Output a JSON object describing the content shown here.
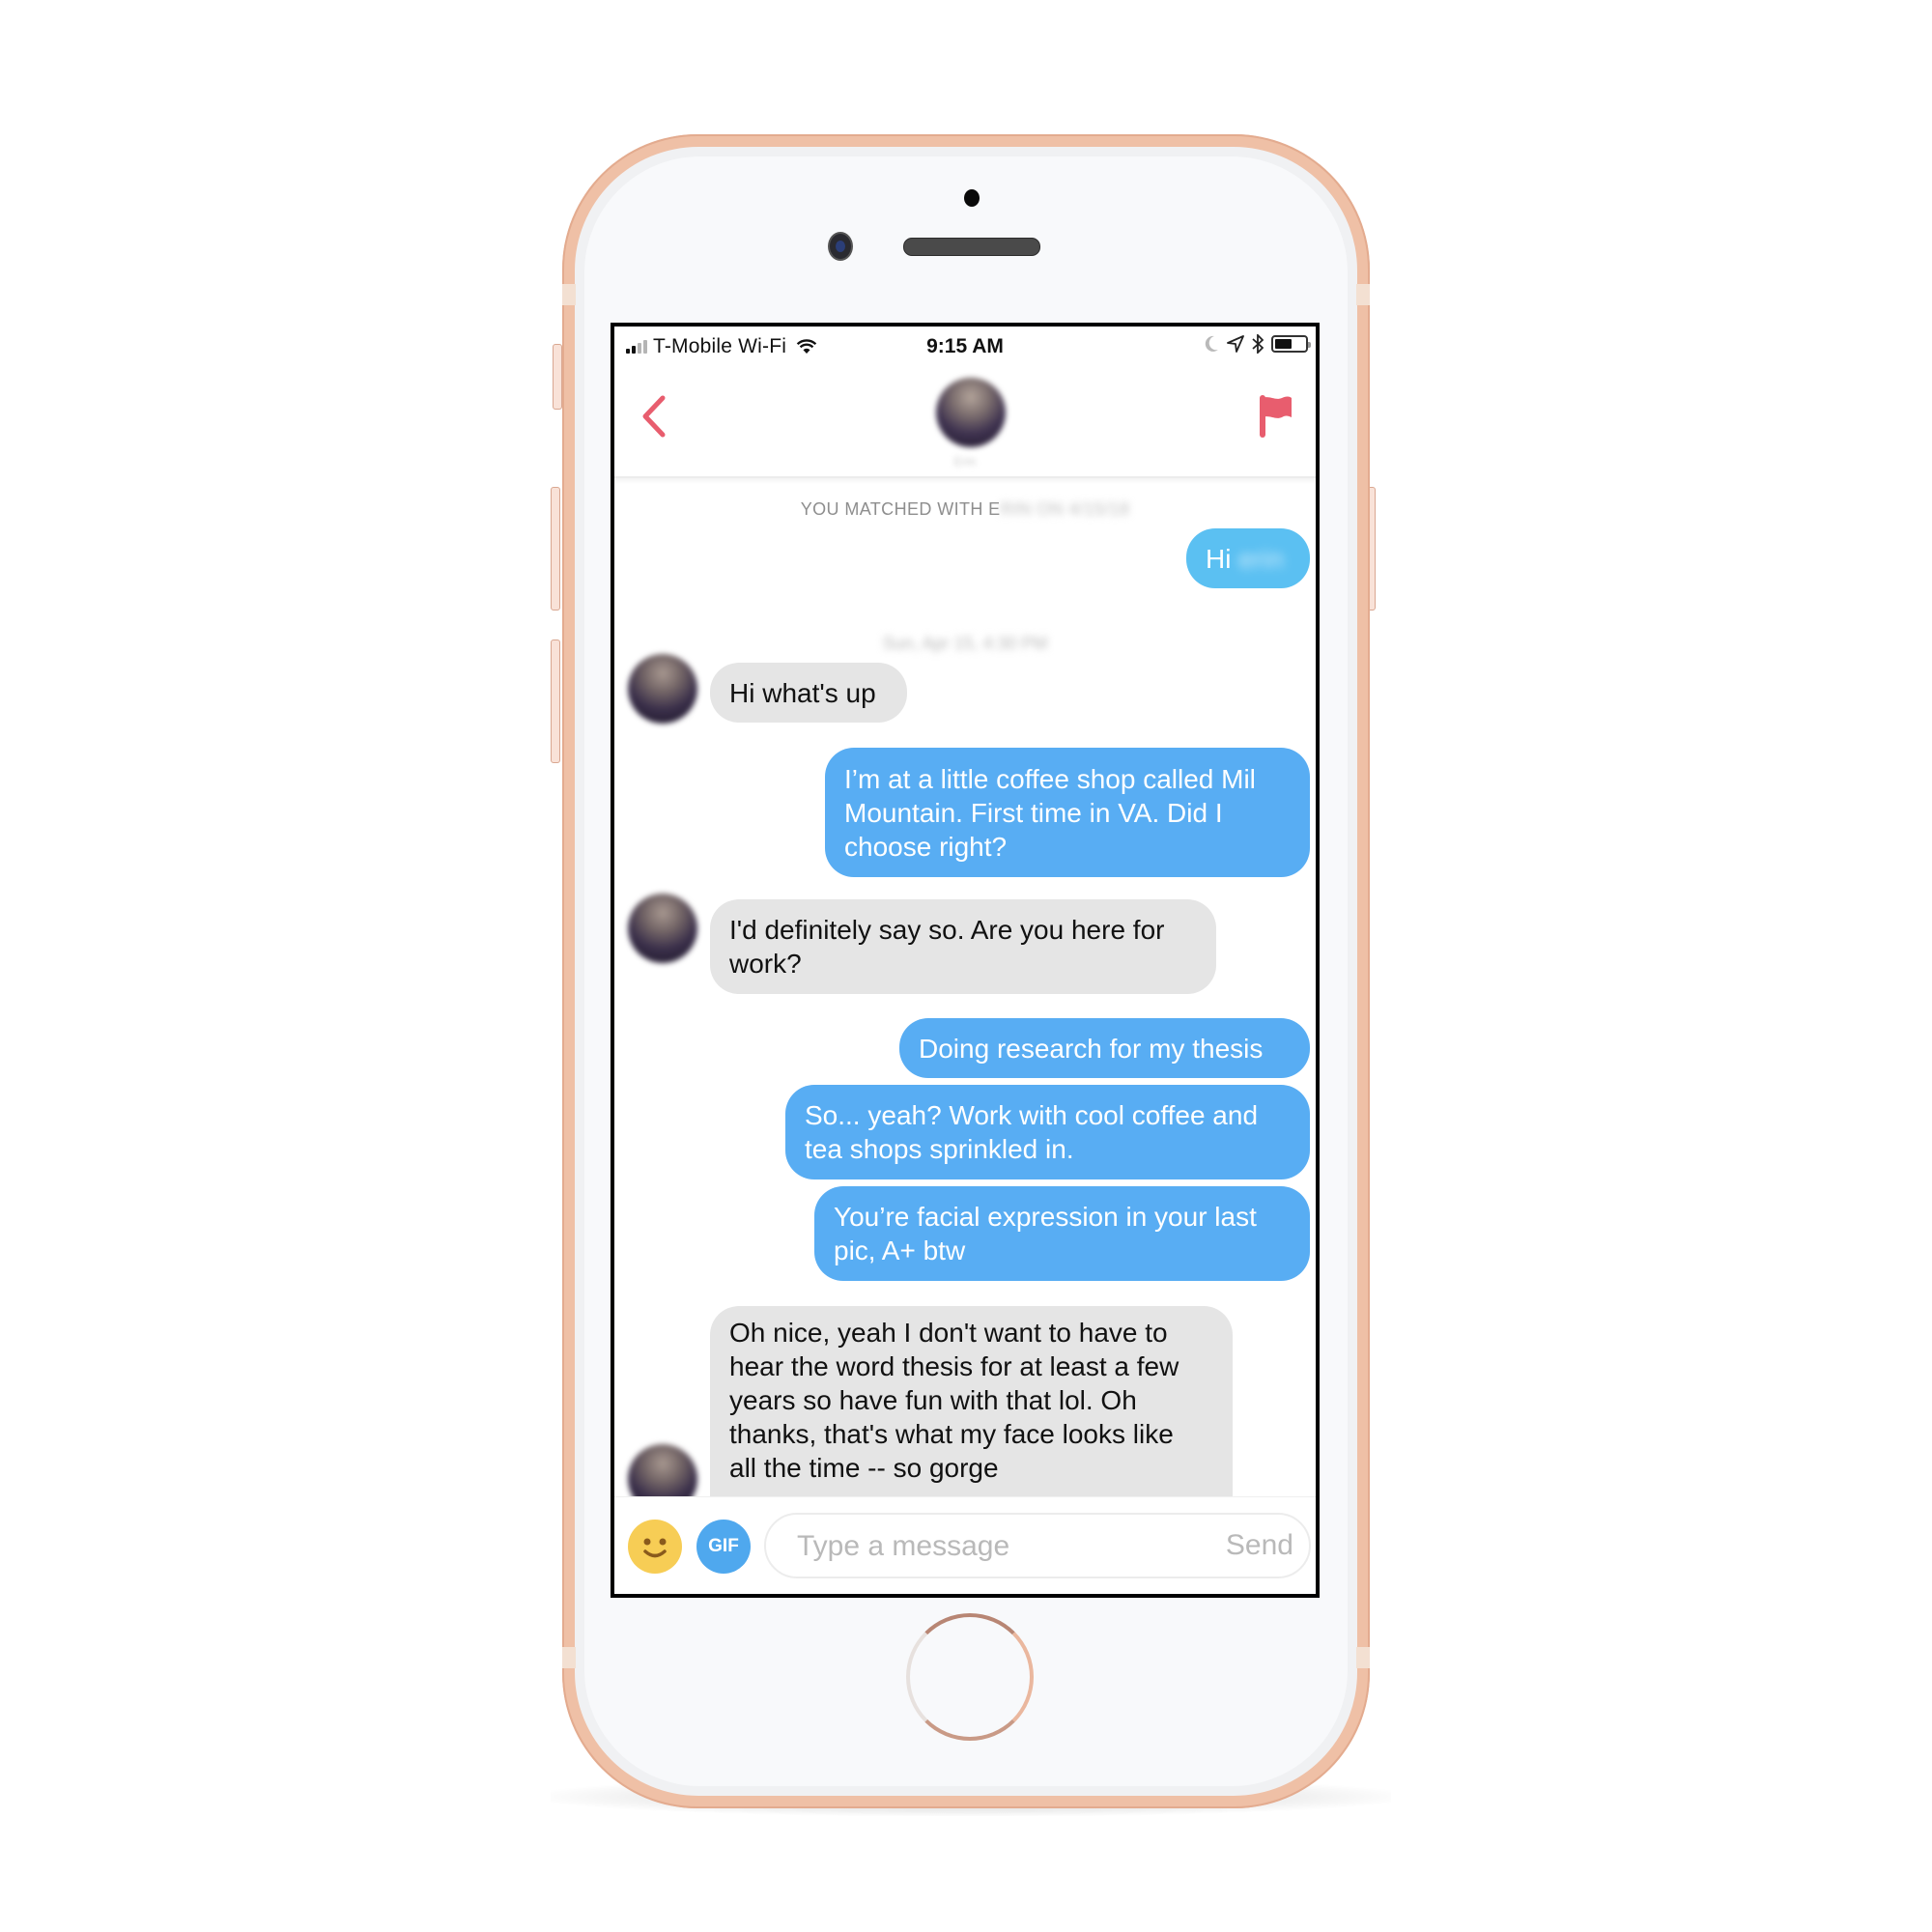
{
  "status_bar": {
    "carrier": "T-Mobile Wi-Fi",
    "time": "9:15 AM",
    "signal_bars_total": 4,
    "signal_bars_active": 2,
    "battery_level": 0.55,
    "icons": [
      "signal-icon",
      "wifi-icon",
      "moon-icon",
      "location-arrow-icon",
      "bluetooth-icon",
      "battery-icon"
    ]
  },
  "header": {
    "back_icon": "chevron-left-icon",
    "report_icon": "flag-icon",
    "match_name": "Erin",
    "accent_color": "#e85d6e"
  },
  "conversation": {
    "match_notice_prefix": "YOU MATCHED WITH E",
    "match_notice_redacted": "RIN ON 4/15/18",
    "timestamp_redacted": "Sun, Apr 15, 4:30 PM",
    "messages": [
      {
        "direction": "out",
        "text": "Hi ",
        "redacted": "erin"
      },
      {
        "direction": "in",
        "text": "Hi what's up"
      },
      {
        "direction": "out",
        "lines": [
          "I’m at a little coffee shop called Mil",
          "Mountain. First time in VA. Did I",
          "choose right?"
        ]
      },
      {
        "direction": "in",
        "lines": [
          "I'd definitely say so. Are you here for",
          "work?"
        ]
      },
      {
        "direction": "out",
        "text": "Doing research for my thesis"
      },
      {
        "direction": "out",
        "lines": [
          "So... yeah? Work with cool coffee and",
          "tea shops sprinkled in."
        ]
      },
      {
        "direction": "out",
        "lines": [
          "You’re facial expression in your last",
          "pic, A+ btw"
        ]
      },
      {
        "direction": "in",
        "lines": [
          "Oh nice, yeah I don't want to have to",
          "hear the word thesis for at least a few",
          "years so have fun with that lol. Oh",
          "thanks, that's what my face looks like",
          "all the time -- so gorge"
        ]
      }
    ],
    "outgoing_color": "#58adf3",
    "incoming_color": "#e5e5e5"
  },
  "composer": {
    "emoji_icon": "smiley-icon",
    "gif_label": "GIF",
    "placeholder": "Type a message",
    "value": "",
    "send_label": "Send"
  }
}
